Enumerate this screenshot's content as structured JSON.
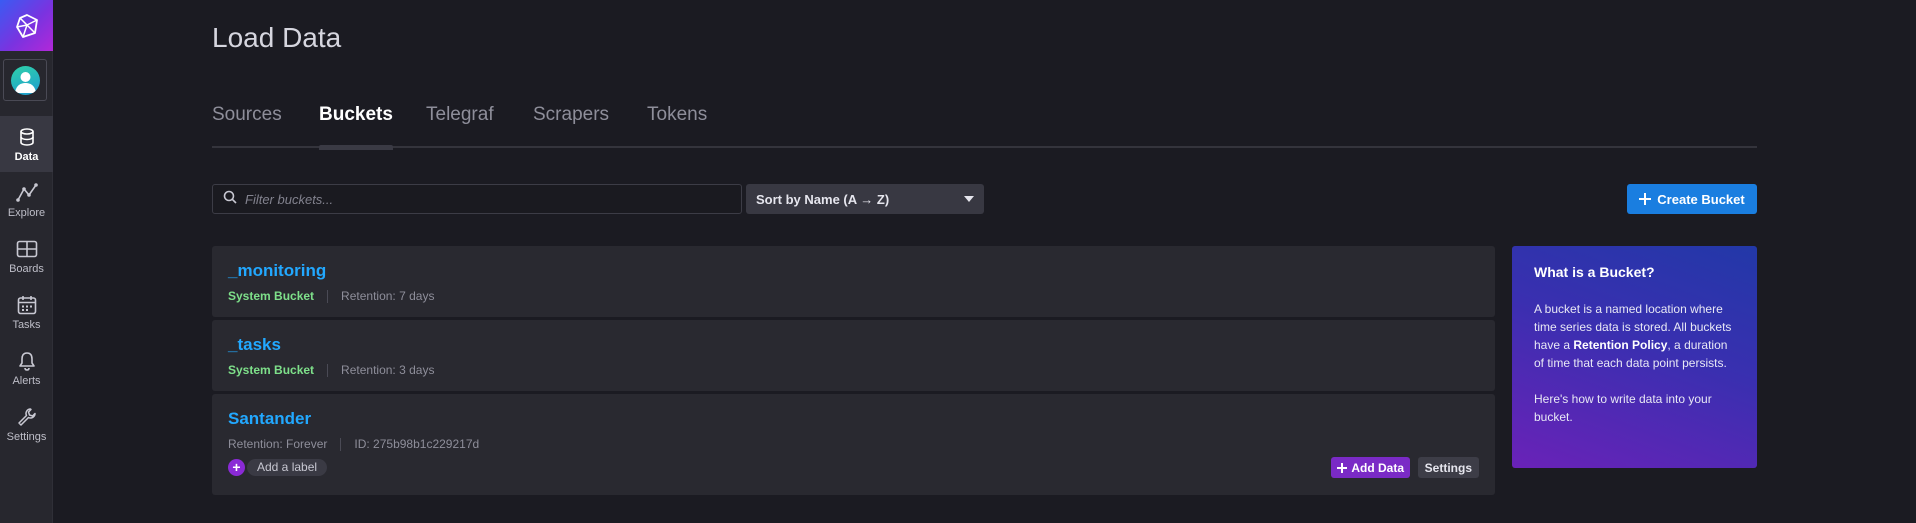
{
  "nav": {
    "items": [
      {
        "label": "Data",
        "icon": "database-icon",
        "active": true
      },
      {
        "label": "Explore",
        "icon": "explore-graph-icon",
        "active": false
      },
      {
        "label": "Boards",
        "icon": "dashboards-icon",
        "active": false
      },
      {
        "label": "Tasks",
        "icon": "calendar-icon",
        "active": false
      },
      {
        "label": "Alerts",
        "icon": "bell-icon",
        "active": false
      },
      {
        "label": "Settings",
        "icon": "wrench-icon",
        "active": false
      }
    ]
  },
  "page": {
    "title": "Load Data"
  },
  "tabs": [
    {
      "label": "Sources",
      "active": false
    },
    {
      "label": "Buckets",
      "active": true
    },
    {
      "label": "Telegraf",
      "active": false
    },
    {
      "label": "Scrapers",
      "active": false
    },
    {
      "label": "Tokens",
      "active": false
    }
  ],
  "toolbar": {
    "filter_placeholder": "Filter buckets...",
    "sort_label": "Sort by Name (A → Z)",
    "create_label": "Create Bucket"
  },
  "buckets": [
    {
      "name": "_monitoring",
      "type": "System Bucket",
      "retention": "Retention: 7 days"
    },
    {
      "name": "_tasks",
      "type": "System Bucket",
      "retention": "Retention: 3 days"
    },
    {
      "name": "Santander",
      "retention": "Retention: Forever",
      "id": "ID: 275b98b1c229217d",
      "add_label": "Add a label",
      "add_data": "Add Data",
      "settings": "Settings"
    }
  ],
  "info": {
    "title": "What is a Bucket?",
    "p1_a": "A bucket is a named location where time series data is stored. All buckets have a ",
    "p1_bold": "Retention Policy",
    "p1_b": ", a duration of time that each data point persists.",
    "p2_a": "Here's ",
    "p2_link": "how to write data",
    "p2_b": " into your bucket."
  },
  "colors": {
    "accent_blue": "#1a7ee0",
    "link_blue": "#22a8ff",
    "system_green": "#7ee08a",
    "purple": "#7a2ac6"
  }
}
